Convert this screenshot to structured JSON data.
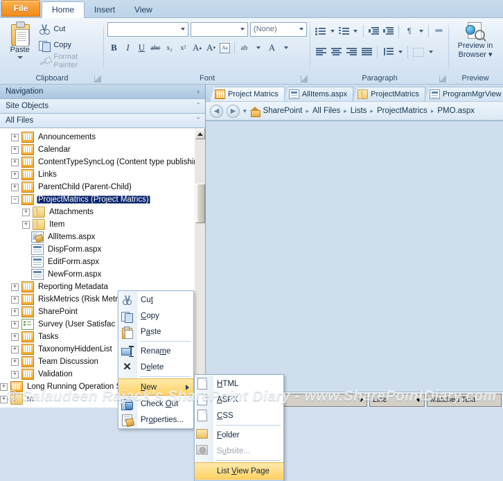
{
  "ribbon": {
    "file_tab": "File",
    "tabs": [
      {
        "label": "Home",
        "active": true
      },
      {
        "label": "Insert",
        "active": false
      },
      {
        "label": "View",
        "active": false
      }
    ],
    "clipboard": {
      "group_label": "Clipboard",
      "paste_label": "Paste",
      "cut_label": "Cut",
      "copy_label": "Copy",
      "format_painter_label": "Format Painter"
    },
    "font": {
      "group_label": "Font",
      "font_name_value": "",
      "font_size_value": "",
      "style_value": "(None)",
      "bold": "B",
      "italic": "I",
      "underline": "U",
      "strike": "abc",
      "subscript": "x₂",
      "superscript": "x²",
      "grow_font": "A",
      "shrink_font": "A",
      "clear_format": "Aa",
      "highlight": "ab",
      "font_color": "A"
    },
    "paragraph": {
      "group_label": "Paragraph",
      "bullets": "bullet-list-icon",
      "numbering": "numbered-list-icon",
      "decrease_indent": "decrease-indent-icon",
      "increase_indent": "increase-indent-icon",
      "paragraph_mark": "pilcrow-icon",
      "align_left": "align-left-icon",
      "align_center": "align-center-icon",
      "align_right": "align-right-icon",
      "justify": "justify-icon",
      "line_spacing": "line-spacing-icon",
      "borders": "borders-icon"
    },
    "preview": {
      "group_label": "Preview",
      "button_line1": "Preview in",
      "button_line2": "Browser"
    }
  },
  "panes": {
    "navigation": {
      "title": "Navigation",
      "chevron": "‹"
    },
    "site_objects": {
      "title": "Site Objects",
      "chevron": "ˇ"
    },
    "all_files": {
      "title": "All Files",
      "chevron": "ˆ"
    }
  },
  "tree": [
    {
      "label": "Announcements",
      "indent": 1,
      "icon": "list-icon",
      "expander": "+"
    },
    {
      "label": "Calendar",
      "indent": 1,
      "icon": "list-icon",
      "expander": "+"
    },
    {
      "label": "ContentTypeSyncLog (Content type publishin",
      "indent": 1,
      "icon": "list-icon",
      "expander": "+"
    },
    {
      "label": "Links",
      "indent": 1,
      "icon": "list-icon",
      "expander": "+"
    },
    {
      "label": "ParentChild (Parent-Child)",
      "indent": 1,
      "icon": "list-icon",
      "expander": "+"
    },
    {
      "label": "ProjectMatrics (Project Matrics)",
      "indent": 1,
      "icon": "list-icon",
      "expander": "−",
      "selected": true
    },
    {
      "label": "Attachments",
      "indent": 2,
      "icon": "folder-icon",
      "expander": "+"
    },
    {
      "label": "Item",
      "indent": 2,
      "icon": "folder-icon",
      "expander": "+"
    },
    {
      "label": "AllItems.aspx",
      "indent": 2,
      "icon": "allitems-page-icon",
      "expander": ""
    },
    {
      "label": "DispForm.aspx",
      "indent": 2,
      "icon": "aspx-page-icon",
      "expander": ""
    },
    {
      "label": "EditForm.aspx",
      "indent": 2,
      "icon": "aspx-page-icon",
      "expander": ""
    },
    {
      "label": "NewForm.aspx",
      "indent": 2,
      "icon": "aspx-page-icon",
      "expander": ""
    },
    {
      "label": "Reporting Metadata",
      "indent": 1,
      "icon": "list-icon",
      "expander": "+"
    },
    {
      "label": "RiskMetrics (Risk Metri",
      "indent": 1,
      "icon": "list-icon",
      "expander": "+"
    },
    {
      "label": "SharePoint",
      "indent": 1,
      "icon": "list-icon",
      "expander": "+"
    },
    {
      "label": "Survey (User Satisfac",
      "indent": 1,
      "icon": "survey-icon",
      "expander": "+"
    },
    {
      "label": "Tasks",
      "indent": 1,
      "icon": "list-icon",
      "expander": "+"
    },
    {
      "label": "TaxonomyHiddenList",
      "indent": 1,
      "icon": "list-icon",
      "expander": "+"
    },
    {
      "label": "Team Discussion",
      "indent": 1,
      "icon": "list-icon",
      "expander": "+"
    },
    {
      "label": "Validation",
      "indent": 1,
      "icon": "list-icon",
      "expander": "+"
    },
    {
      "label": "Long Running Operation Status",
      "indent": 0,
      "icon": "list-icon",
      "expander": "+"
    },
    {
      "label": "m",
      "indent": 0,
      "icon": "folder-icon",
      "expander": "+"
    }
  ],
  "doc_tabs": [
    {
      "label": "Project Matrics",
      "icon": "list-view-icon"
    },
    {
      "label": "AllItems.aspx",
      "icon": "aspx-page-icon"
    },
    {
      "label": "ProjectMatrics",
      "icon": "folder-icon"
    },
    {
      "label": "ProgramMgrView",
      "icon": "aspx-page-icon"
    }
  ],
  "breadcrumb": {
    "back": "◀",
    "forward": "▶",
    "dropdown": "▾",
    "items": [
      "SharePoint",
      "All Files",
      "Lists",
      "ProjectMatrics",
      "PMO.aspx"
    ],
    "separator": "▸"
  },
  "context_menu": {
    "items": [
      {
        "label": "Cut",
        "accel_index": 2,
        "icon": "scissors-icon"
      },
      {
        "label": "Copy",
        "accel_index": 0,
        "icon": "copy-icon"
      },
      {
        "label": "Paste",
        "accel_index": 1,
        "icon": "paste-icon"
      },
      {
        "separator": true
      },
      {
        "label": "Rename",
        "accel_index": 4,
        "icon": "rename-icon"
      },
      {
        "label": "Delete",
        "accel_index": 1,
        "icon": "delete-icon"
      },
      {
        "separator": true
      },
      {
        "label": "New",
        "accel_index": 0,
        "icon": "none",
        "submenu": true,
        "highlighted": true
      },
      {
        "label": "Check Out",
        "accel_index": 6,
        "icon": "checkout-icon"
      },
      {
        "label": "Properties...",
        "accel_index": 2,
        "icon": "properties-icon"
      }
    ]
  },
  "submenu": {
    "items": [
      {
        "label": "HTML",
        "accel_index": 0,
        "icon": "page-icon"
      },
      {
        "label": "ASPX",
        "accel_index": 0,
        "icon": "page-icon"
      },
      {
        "label": "CSS",
        "accel_index": 0,
        "icon": "page-icon"
      },
      {
        "separator": true
      },
      {
        "label": "Folder",
        "accel_index": 0,
        "icon": "new-folder-icon"
      },
      {
        "label": "Subsite...",
        "accel_index": 1,
        "icon": "subsite-icon",
        "disabled": true
      },
      {
        "separator": true
      },
      {
        "label": "List View Page",
        "accel_index": 5,
        "icon": "none",
        "highlighted": true
      }
    ]
  },
  "find_bar": {
    "find_value": "",
    "line_label": "Line",
    "matched_text_label": "Matched Text"
  },
  "watermark": "© Salaudeen Rajack's SharePoint Diary - www.SharePointDiary.com",
  "colors": {
    "file_tab_orange": "#f08a1c",
    "ribbon_blue": "#dbe8f5",
    "selection_navy": "#08246b",
    "menu_highlight": "#ffd265",
    "editor_bg": "#cfdeec"
  }
}
